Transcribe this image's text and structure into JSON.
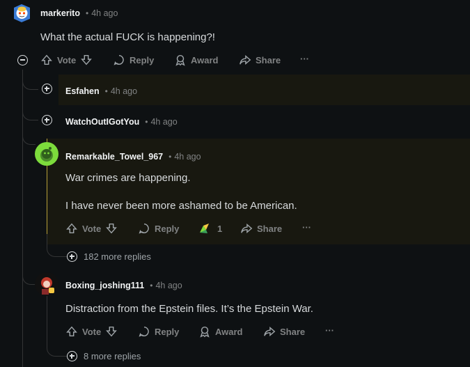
{
  "comments": {
    "c1": {
      "user": "markerito",
      "time": "4h ago",
      "text": "What the actual FUCK is happening?!"
    },
    "c2": {
      "user": "Esfahen",
      "time": "4h ago"
    },
    "c3": {
      "user": "WatchOutIGotYou",
      "time": "4h ago"
    },
    "c4": {
      "user": "Remarkable_Towel_967",
      "time": "4h ago",
      "text1": "War crimes are happening.",
      "text2": "I have never been more ashamed to be American.",
      "award_count": "1",
      "more_replies": "182 more replies"
    },
    "c5": {
      "user": "Boxing_joshing111",
      "time": "4h ago",
      "text": "Distraction from the Epstein files. It’s the Epstein War.",
      "more_replies": "8 more replies"
    }
  },
  "actions": {
    "vote": "Vote",
    "reply": "Reply",
    "award": "Award",
    "share": "Share",
    "more": "···",
    "separator": "•"
  },
  "colors": {
    "background": "#0e1113",
    "highlight": "#181810",
    "accent_avatar": "#7ddc3c"
  },
  "icons": [
    "upvote-icon",
    "downvote-icon",
    "reply-icon",
    "award-icon",
    "share-icon",
    "more-icon",
    "collapse-icon",
    "expand-icon",
    "award-badge-icon"
  ]
}
